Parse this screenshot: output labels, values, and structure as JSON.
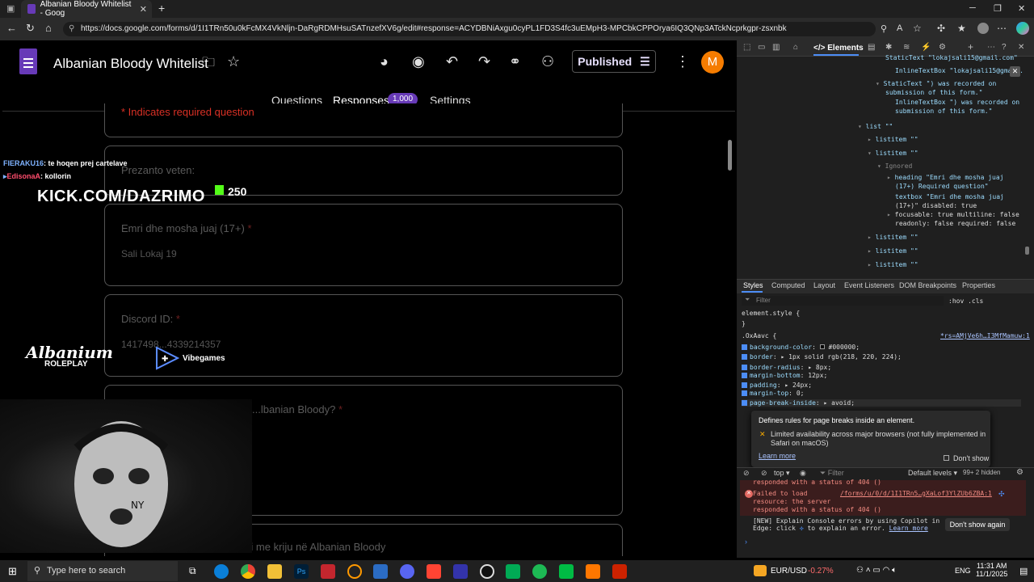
{
  "browser": {
    "tab_title": "Albanian Bloody Whitelist - Goog",
    "url": "https://docs.google.com/forms/d/1I1TRn50u0kFcMX4VkNljn-DaRgRDMHsuSATnzefXV6g/edit#response=ACYDBNiAxgu0cyPL1FD3S4fc3uEMpH3-MPCbkCPPOrya6IQ3QNp3ATckNcprkgpr-zsxnbk"
  },
  "form": {
    "title": "Albanian Bloody Whitelist",
    "published_label": "Published",
    "avatar_letter": "M",
    "tabs": {
      "questions": "Questions",
      "responses": "Responses",
      "settings": "Settings"
    },
    "response_count": "1,000",
    "required_note": "* Indicates required question",
    "section_title": "Prezanto veten:",
    "q1": {
      "label": "Emri dhe mosha juaj (17+)",
      "answer": "Sali Lokaj 19"
    },
    "q2": {
      "label": "Discord ID:",
      "answer": "1417498...4339214357"
    },
    "q3": {
      "label": "...lbanian Bloody?"
    },
    "q4": {
      "label": "Personazhi juaj që dëshironi me kriju në Albanian Bloody"
    },
    "required_star": "*"
  },
  "overlay": {
    "chat": [
      {
        "user": "FIERAKU16",
        "text": ": te hoqen prej cartelave",
        "color": "#7fb3ff"
      },
      {
        "user": "EdisonaA",
        "text": ": kollorin",
        "color": "#ff4d6d"
      }
    ],
    "kick_url": "KICK.COM/DAZRIMO",
    "kick_count": "250",
    "albanium": "Albanium",
    "roleplay": "ROLEPLAY",
    "vibegames": "Vibegames"
  },
  "devtools": {
    "elements_tab": "Elements",
    "tree": {
      "l1": "StaticText \"lokajsali15@gmail.com\"",
      "l2": "InlineTextBox \"lokajsali15@gmail.",
      "l3a": "StaticText \") was recorded on",
      "l3b": "submission of this form.\"",
      "l4a": "InlineTextBox \") was recorded on",
      "l4b": "submission of this form.\"",
      "list": "list \"\"",
      "listitem": "listitem \"\"",
      "ignored": "Ignored",
      "heading1": "heading \"Emri dhe mosha juaj",
      "heading2": "(17+) Required question\"",
      "textbox1": "textbox \"Emri dhe mosha juaj",
      "textbox2": "(17+)\" disabled: true",
      "textbox3": "focusable: true multiline: false",
      "textbox4": "readonly: false required: false"
    },
    "styles_tabs": [
      "Styles",
      "Computed",
      "Layout",
      "Event Listeners",
      "DOM Breakpoints",
      "Properties"
    ],
    "filter_placeholder": "Filter",
    "hov": ":hov .cls",
    "element_style": "element.style {",
    "close_brace": "}",
    "rule_selector": ".OxAavc {",
    "rule_source": "*rs=AMjVe6h…I3MfMamuw:1",
    "props": [
      {
        "name": "background-color",
        "value": "#000000;"
      },
      {
        "name": "border",
        "value": "1px solid rgb(218, 220, 224);"
      },
      {
        "name": "border-radius",
        "value": "8px;"
      },
      {
        "name": "margin-bottom",
        "value": "12px;"
      },
      {
        "name": "padding",
        "value": "24px;"
      },
      {
        "name": "margin-top",
        "value": "0;"
      },
      {
        "name": "page-break-inside",
        "value": "avoid;"
      }
    ],
    "tooltip": {
      "title": "Defines rules for page breaks inside an element.",
      "warning": "Limited availability across major browsers (not fully implemented in Safari on macOS)",
      "learn_more": "Learn more",
      "dont_show": "Don't show"
    },
    "console": {
      "context": "top",
      "filter": "Filter",
      "levels": "Default levels",
      "hidden": "99+  2 hidden",
      "err1": "responded with a status of 404 ()",
      "err2a": "Failed to load",
      "err2link": "/forms/u/0/d/1I1TRn5…gXaLof3YlZUb6ZBA:1",
      "err2b": "resource: the server",
      "err2c": "responded with a status of 404 ()",
      "info1": "[NEW] Explain Console errors by using Copilot in",
      "info2": "Edge: click",
      "info3": "to explain an error.",
      "info_link": "Learn more",
      "dont_show_again": "Don't show again"
    }
  },
  "taskbar": {
    "search_placeholder": "Type here to search",
    "currency": "EUR/USD",
    "currency_change": "-0.27%",
    "lang": "ENG",
    "time": "11:31 AM",
    "date": "11/1/2025"
  }
}
